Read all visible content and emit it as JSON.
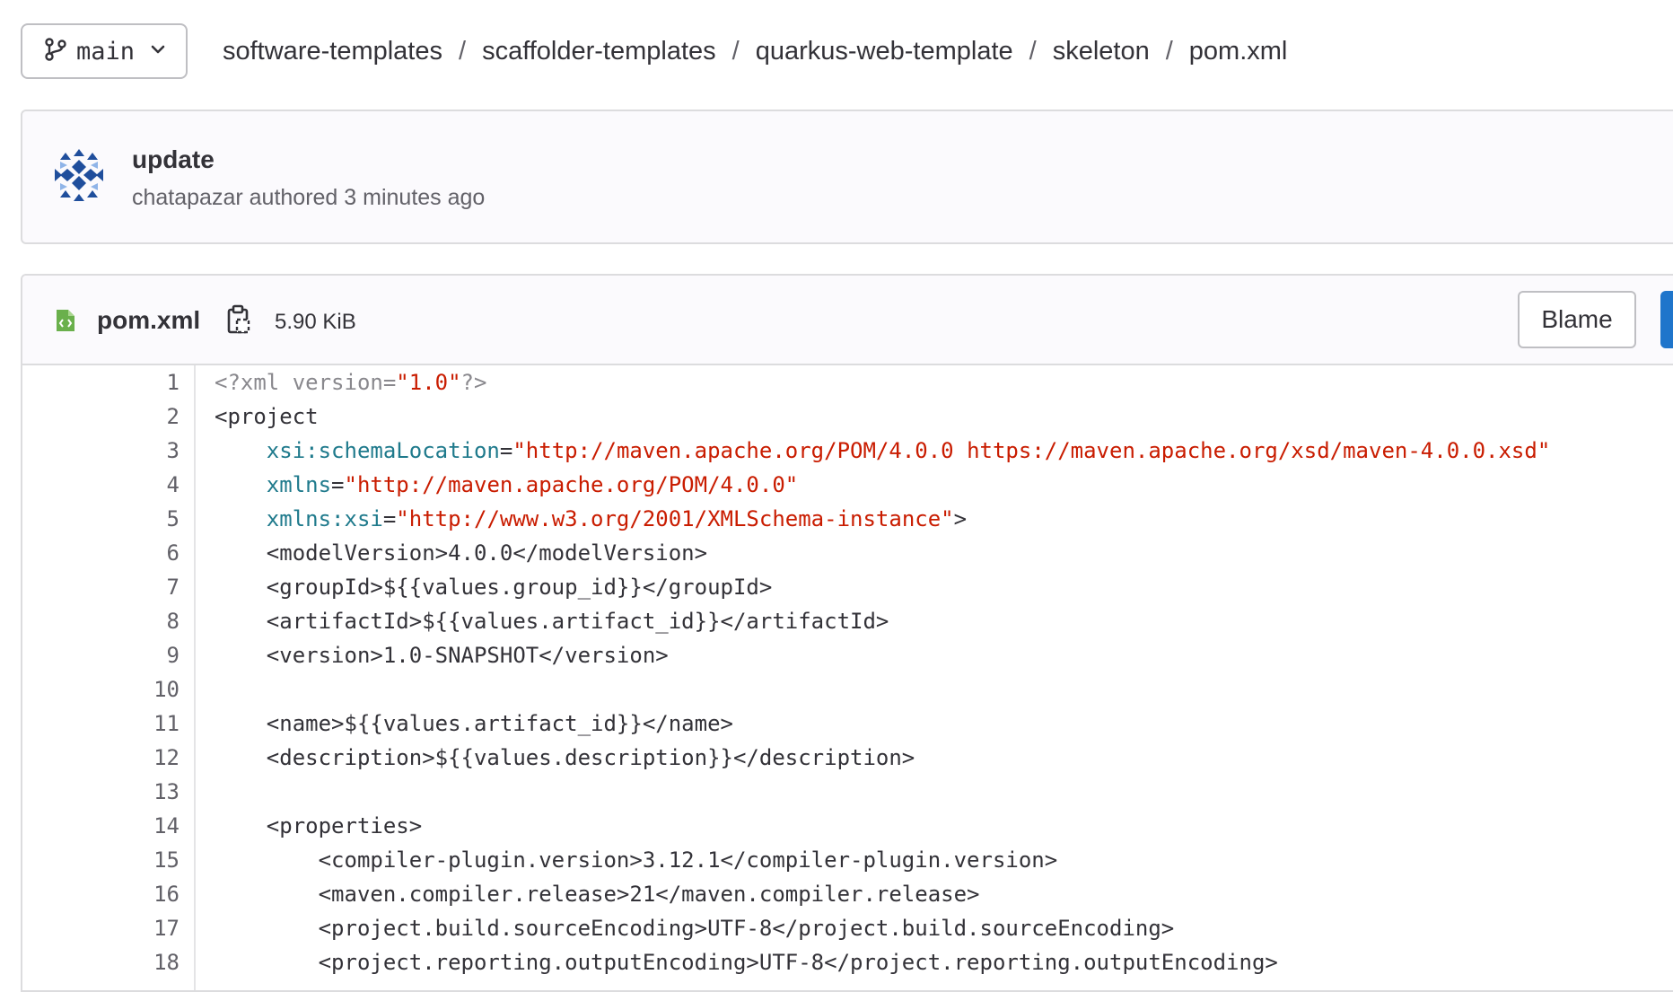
{
  "branch": {
    "label": "main"
  },
  "breadcrumb": {
    "items": [
      "software-templates",
      "scaffolder-templates",
      "quarkus-web-template",
      "skeleton",
      "pom.xml"
    ],
    "separator": "/"
  },
  "commit": {
    "title": "update",
    "meta": "chatapazar authored 3 minutes ago"
  },
  "file": {
    "name": "pom.xml",
    "size": "5.90 KiB",
    "blame_label": "Blame"
  },
  "icons": {
    "branch": "git-branch-icon",
    "chevron": "chevron-down-icon",
    "file": "xml-file-icon",
    "copy": "copy-to-clipboard-icon",
    "avatar": "identicon-avatar"
  },
  "colors": {
    "accent": "#1f75cb",
    "string": "#c91c00",
    "attribute": "#1f7a8c",
    "declaration": "#89888d"
  },
  "code": {
    "lines": [
      {
        "n": "1",
        "indent": "",
        "tokens": [
          [
            "decl",
            "<?xml version="
          ],
          [
            "str",
            "\"1.0\""
          ],
          [
            "decl",
            "?>"
          ]
        ]
      },
      {
        "n": "2",
        "indent": "",
        "tokens": [
          [
            "tag",
            "<project"
          ]
        ]
      },
      {
        "n": "3",
        "indent": "    ",
        "tokens": [
          [
            "attr",
            "xsi:schemaLocation"
          ],
          [
            "tag",
            "="
          ],
          [
            "str",
            "\"http://maven.apache.org/POM/4.0.0 https://maven.apache.org/xsd/maven-4.0.0.xsd\""
          ]
        ]
      },
      {
        "n": "4",
        "indent": "    ",
        "tokens": [
          [
            "attr",
            "xmlns"
          ],
          [
            "tag",
            "="
          ],
          [
            "str",
            "\"http://maven.apache.org/POM/4.0.0\""
          ]
        ]
      },
      {
        "n": "5",
        "indent": "    ",
        "tokens": [
          [
            "attr",
            "xmlns:xsi"
          ],
          [
            "tag",
            "="
          ],
          [
            "str",
            "\"http://www.w3.org/2001/XMLSchema-instance\""
          ],
          [
            "tag",
            ">"
          ]
        ]
      },
      {
        "n": "6",
        "indent": "    ",
        "tokens": [
          [
            "tag",
            "<modelVersion>4.0.0</modelVersion>"
          ]
        ]
      },
      {
        "n": "7",
        "indent": "    ",
        "tokens": [
          [
            "tag",
            "<groupId>${{values.group_id}}</groupId>"
          ]
        ]
      },
      {
        "n": "8",
        "indent": "    ",
        "tokens": [
          [
            "tag",
            "<artifactId>${{values.artifact_id}}</artifactId>"
          ]
        ]
      },
      {
        "n": "9",
        "indent": "    ",
        "tokens": [
          [
            "tag",
            "<version>1.0-SNAPSHOT</version>"
          ]
        ]
      },
      {
        "n": "10",
        "indent": "",
        "tokens": []
      },
      {
        "n": "11",
        "indent": "    ",
        "tokens": [
          [
            "tag",
            "<name>${{values.artifact_id}}</name>"
          ]
        ]
      },
      {
        "n": "12",
        "indent": "    ",
        "tokens": [
          [
            "tag",
            "<description>${{values.description}}</description>"
          ]
        ]
      },
      {
        "n": "13",
        "indent": "",
        "tokens": []
      },
      {
        "n": "14",
        "indent": "    ",
        "tokens": [
          [
            "tag",
            "<properties>"
          ]
        ]
      },
      {
        "n": "15",
        "indent": "        ",
        "tokens": [
          [
            "tag",
            "<compiler-plugin.version>3.12.1</compiler-plugin.version>"
          ]
        ]
      },
      {
        "n": "16",
        "indent": "        ",
        "tokens": [
          [
            "tag",
            "<maven.compiler.release>21</maven.compiler.release>"
          ]
        ]
      },
      {
        "n": "17",
        "indent": "        ",
        "tokens": [
          [
            "tag",
            "<project.build.sourceEncoding>UTF-8</project.build.sourceEncoding>"
          ]
        ]
      },
      {
        "n": "18",
        "indent": "        ",
        "tokens": [
          [
            "tag",
            "<project.reporting.outputEncoding>UTF-8</project.reporting.outputEncoding>"
          ]
        ]
      }
    ]
  }
}
